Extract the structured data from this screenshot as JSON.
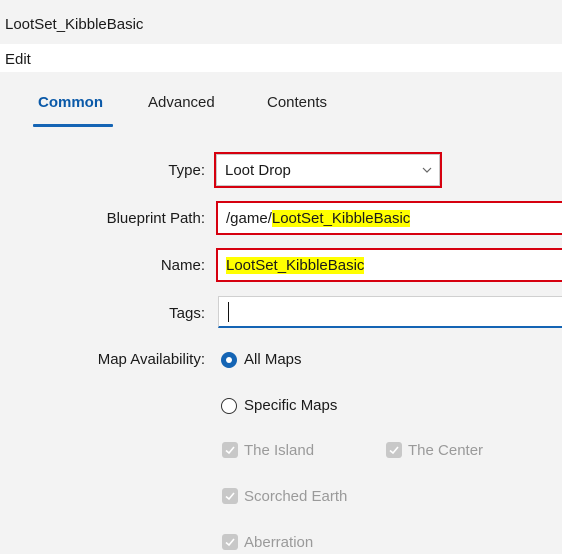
{
  "window": {
    "title": "LootSet_KibbleBasic"
  },
  "menu": {
    "edit": "Edit"
  },
  "tabs": [
    {
      "label": "Common",
      "active": true
    },
    {
      "label": "Advanced",
      "active": false
    },
    {
      "label": "Contents",
      "active": false
    }
  ],
  "form": {
    "type": {
      "label": "Type:",
      "value": "Loot Drop"
    },
    "blueprint_path": {
      "label": "Blueprint Path:",
      "prefix": "/game/",
      "highlighted": "LootSet_KibbleBasic"
    },
    "name": {
      "label": "Name:",
      "value": "LootSet_KibbleBasic"
    },
    "tags": {
      "label": "Tags:",
      "value": ""
    },
    "map_availability": {
      "label": "Map Availability:",
      "options": [
        {
          "label": "All Maps",
          "selected": true
        },
        {
          "label": "Specific Maps",
          "selected": false
        }
      ],
      "maps": [
        {
          "label": "The Island",
          "checked": true,
          "disabled": true
        },
        {
          "label": "The Center",
          "checked": true,
          "disabled": true
        },
        {
          "label": "Scorched Earth",
          "checked": true,
          "disabled": true
        },
        {
          "label": "Aberration",
          "checked": true,
          "disabled": true
        }
      ]
    }
  },
  "colors": {
    "accent": "#1464b4",
    "highlight_box": "#d6000f",
    "text_highlight": "#ffff00",
    "disabled_text": "#9a9a9a"
  }
}
